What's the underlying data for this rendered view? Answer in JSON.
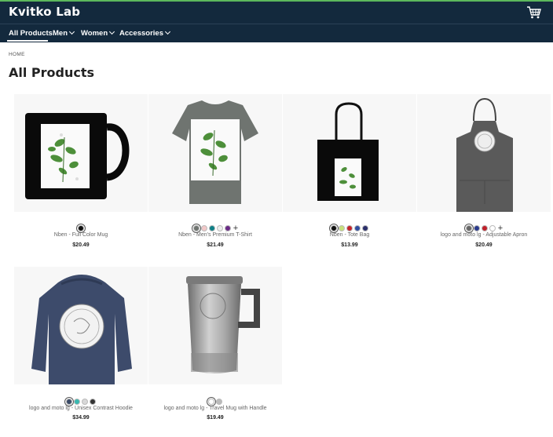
{
  "header": {
    "brand": "Kvitko Lab",
    "cart_icon": "cart-icon"
  },
  "nav": {
    "items": [
      {
        "label": "All Products"
      },
      {
        "label": "Men"
      },
      {
        "label": "Women"
      },
      {
        "label": "Accessories"
      }
    ]
  },
  "breadcrumb": "HOME",
  "page_title": "All Products",
  "colors": {
    "header_bg": "#13293d",
    "accent_line": "#5cb85c"
  },
  "products": [
    {
      "name": "Nben - Full Color Mug",
      "price": "$20.49",
      "swatches": [
        "#111111"
      ],
      "more": ""
    },
    {
      "name": "Nben - Men's Premium T-Shirt",
      "price": "$21.49",
      "swatches": [
        "#6f7470",
        "#f2c8c8",
        "#0e7f86",
        "#eeeeee",
        "#6a2a86"
      ],
      "more": "+"
    },
    {
      "name": "Nben - Tote Bag",
      "price": "$13.99",
      "swatches": [
        "#111111",
        "#c7e07a",
        "#c5232b",
        "#2f4da0",
        "#2b2f6b"
      ],
      "more": ""
    },
    {
      "name": "logo and moto lg - Adjustable Apron",
      "price": "$20.49",
      "swatches": [
        "#666666",
        "#2a3a8c",
        "#c0202a",
        "#ffffff"
      ],
      "more": "+"
    },
    {
      "name": "logo and moto lg - Unisex Contrast Hoodie",
      "price": "$34.99",
      "swatches": [
        "#3a4a66",
        "#39b8b0",
        "#d8d8d8",
        "#333333"
      ],
      "more": ""
    },
    {
      "name": "logo and moto lg - Travel Mug with Handle",
      "price": "$19.49",
      "swatches": [
        "#ffffff",
        "#bbbbbb"
      ],
      "more": ""
    }
  ]
}
